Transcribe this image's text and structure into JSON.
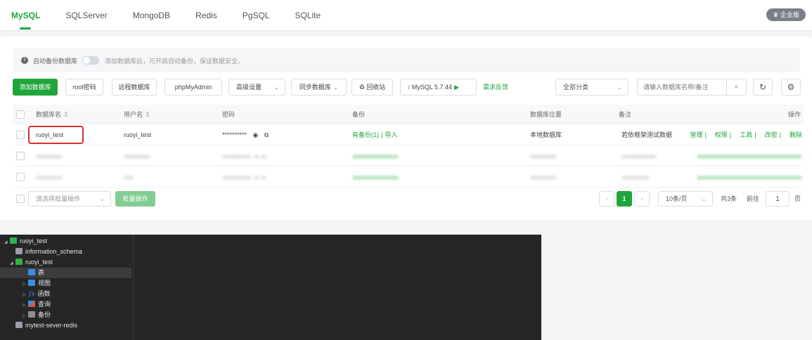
{
  "tabs": [
    "MySQL",
    "SQLServer",
    "MongoDB",
    "Redis",
    "PgSQL",
    "SQLite"
  ],
  "active_tab": "MySQL",
  "pro_badge": "企业版",
  "notice": {
    "label": "自动备份数据库",
    "hint": "添加数据库后，可开启自动备份，保证数据安全。"
  },
  "toolbar": {
    "add_db": "添加数据库",
    "root_pwd": "root密码",
    "remote_db": "远程数据库",
    "phpmyadmin": "phpMyAdmin",
    "advanced": "高级设置",
    "sync": "同步数据库",
    "recycle": "回收站",
    "version": "MySQL 5.7.44",
    "feedback": "需求反馈",
    "category": "全部分类",
    "search_placeholder": "请输入数据库名称/备注"
  },
  "table": {
    "headers": [
      "数据库名",
      "用户名",
      "密码",
      "备份",
      "数据库位置",
      "备注",
      "操作"
    ],
    "row1": {
      "name": "ruoyi_test",
      "user": "ruoyi_test",
      "password": "**********",
      "backup": "有备份(1)",
      "import": "导入",
      "location": "本地数据库",
      "remark": "若依框架测试数据",
      "ops": [
        "管理",
        "权限",
        "工具",
        "改密",
        "删除"
      ]
    }
  },
  "footer": {
    "batch_placeholder": "请选择批量操作",
    "batch_btn": "批量操作",
    "page": "1",
    "page_size": "10条/页",
    "total": "共3条",
    "goto": "前往",
    "goto_page": "1",
    "page_unit": "页"
  },
  "tree": {
    "connection": "ruoyi_test",
    "db1": "information_schema",
    "db2": "ruoyi_test",
    "tables": "表",
    "views": "视图",
    "functions": "函数",
    "queries": "查询",
    "backups": "备份",
    "redis": "mytest-sever-redis"
  },
  "colors": {
    "accent": "#20a53a",
    "highlight": "#d9302b",
    "dark": "#262626"
  }
}
